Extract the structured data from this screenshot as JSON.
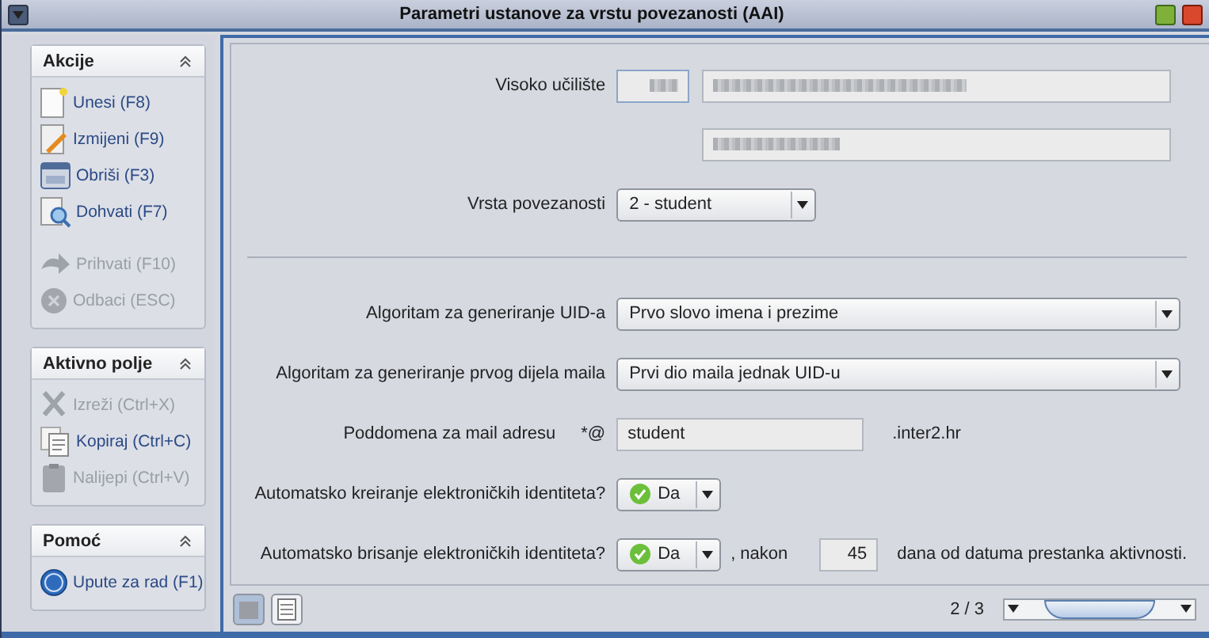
{
  "window": {
    "title": "Parametri ustanove za vrstu povezanosti (AAI)"
  },
  "sidebar": {
    "sections": [
      {
        "title": "Akcije",
        "items": [
          {
            "label": "Unesi (F8)",
            "disabled": false
          },
          {
            "label": "Izmijeni (F9)",
            "disabled": false
          },
          {
            "label": "Obriši (F3)",
            "disabled": false
          },
          {
            "label": "Dohvati (F7)",
            "disabled": false
          },
          {
            "label": "Prihvati (F10)",
            "disabled": true
          },
          {
            "label": "Odbaci (ESC)",
            "disabled": true
          }
        ]
      },
      {
        "title": "Aktivno polje",
        "items": [
          {
            "label": "Izreži (Ctrl+X)",
            "disabled": true
          },
          {
            "label": "Kopiraj (Ctrl+C)",
            "disabled": false
          },
          {
            "label": "Nalijepi (Ctrl+V)",
            "disabled": true
          }
        ]
      },
      {
        "title": "Pomoć",
        "items": [
          {
            "label": "Upute za rad (F1)",
            "disabled": false
          }
        ]
      }
    ]
  },
  "form": {
    "top_rows": [
      {
        "kind": "institution",
        "label": "Visoko učilište"
      },
      {
        "kind": "dropdown",
        "label": "Vrsta povezanosti",
        "value": "2 - student"
      }
    ],
    "bottom_rows": [
      {
        "kind": "select",
        "label": "Algoritam za generiranje UID-a",
        "value": "Prvo slovo imena i prezime"
      },
      {
        "kind": "select",
        "label": "Algoritam za generiranje prvog dijela maila",
        "value": "Prvi dio maila jednak UID-u"
      },
      {
        "kind": "text",
        "label": "Poddomena za mail adresu",
        "prefix": "*@",
        "value": "student",
        "suffix": ".inter2.hr"
      },
      {
        "kind": "yesno",
        "label": "Automatsko kreiranje elektroničkih identiteta?",
        "value": "Da"
      },
      {
        "kind": "yesno",
        "label": "Automatsko brisanje elektroničkih identiteta?",
        "value": "Da",
        "after": ", nakon",
        "number": "45",
        "suffix": "dana od datuma prestanka aktivnosti."
      }
    ]
  },
  "footer": {
    "page": "2 / 3"
  }
}
